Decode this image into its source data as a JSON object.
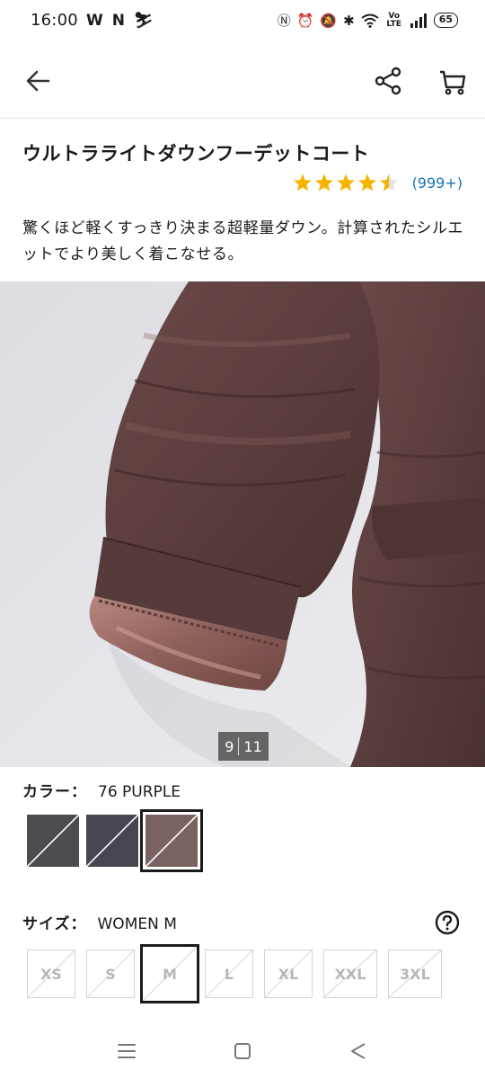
{
  "status_bar": {
    "time": "16:00",
    "left_icons": [
      "W",
      "N",
      "⛷"
    ],
    "battery": "65",
    "signal_text": "Vo LTE"
  },
  "header": {
    "back_icon": "arrow-left-icon",
    "share_icon": "share-icon",
    "cart_icon": "cart-icon"
  },
  "product": {
    "title": "ウルトラライトダウンフーデットコート",
    "rating_value": 4.5,
    "review_count": "(999+)",
    "description": "驚くほど軽くすっきり決まる超軽量ダウン。計算されたシルエットでより美しく着こなせる。"
  },
  "gallery": {
    "current": "9",
    "total": "11"
  },
  "color": {
    "label": "カラー：",
    "selected": "76 PURPLE",
    "swatches": [
      {
        "hex": "#4b4c50",
        "selected": false
      },
      {
        "hex": "#46474f",
        "selected": false
      },
      {
        "hex": "#7a6262",
        "selected": true
      }
    ]
  },
  "size": {
    "label": "サイズ：",
    "selected": "WOMEN M",
    "options": [
      {
        "label": "XS",
        "selected": false
      },
      {
        "label": "S",
        "selected": false
      },
      {
        "label": "M",
        "selected": true
      },
      {
        "label": "L",
        "selected": false
      },
      {
        "label": "XL",
        "selected": false
      },
      {
        "label": "XXL",
        "selected": false
      },
      {
        "label": "3XL",
        "selected": false
      }
    ]
  },
  "nav": {
    "recent_icon": "menu-icon",
    "home_icon": "square-icon",
    "back_icon": "triangle-back-icon"
  },
  "colors": {
    "star": "#f5b400",
    "link": "#1a74b8",
    "coat": "#5a3d3d",
    "lining": "#9a6a64"
  }
}
